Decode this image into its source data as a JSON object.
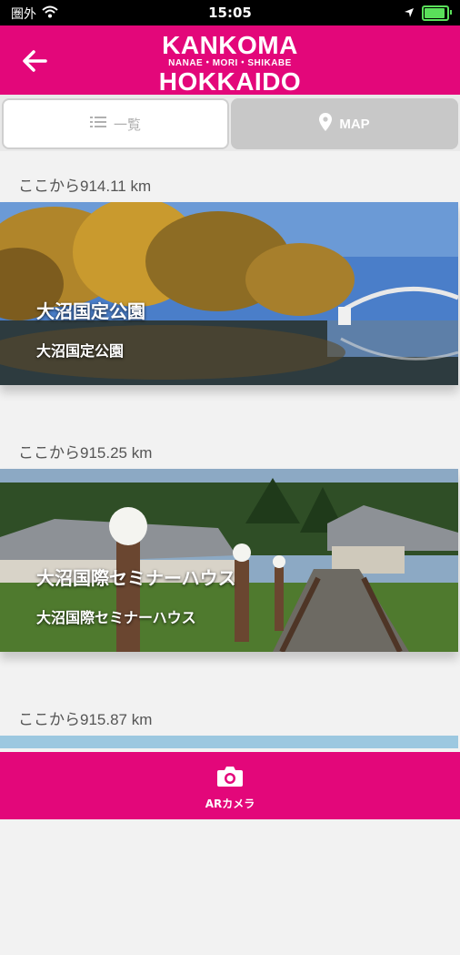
{
  "status_bar": {
    "carrier": "圏外",
    "time": "15:05",
    "battery_level": 0.85
  },
  "header": {
    "logo_line1": "KANKOMA",
    "logo_line2": "NANAE・MORI・SHIKABE",
    "logo_line3": "HOKKAIDO",
    "back_icon": "arrow-left-icon"
  },
  "tabs": [
    {
      "label": "一覧",
      "icon": "list-icon",
      "selected": true
    },
    {
      "label": "MAP",
      "icon": "map-pin-icon",
      "selected": false
    }
  ],
  "spots": [
    {
      "distance": "ここから914.11 km",
      "title": "大沼国定公園",
      "subtitle": "大沼国定公園"
    },
    {
      "distance": "ここから915.25 km",
      "title": "大沼国際セミナーハウス",
      "subtitle": "大沼国際セミナーハウス"
    },
    {
      "distance": "ここから915.87 km"
    }
  ],
  "bottom_bar": {
    "ar_label": "ARカメラ",
    "ar_icon": "camera-icon"
  },
  "colors": {
    "brand": "#e3077a",
    "tab_inactive": "#c8c8c8"
  }
}
